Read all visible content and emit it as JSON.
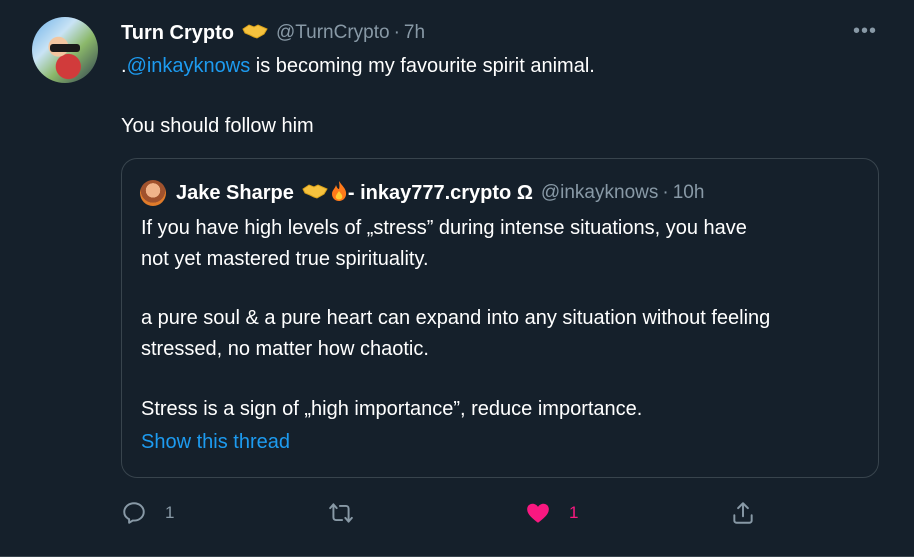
{
  "tweet": {
    "author_name": "Turn Crypto",
    "author_emoji": "handshake",
    "handle": "@TurnCrypto",
    "separator": "·",
    "time": "7h",
    "more_label": "•••",
    "text_prefix": ".",
    "mention": "@inkayknows",
    "text_suffix": " is becoming my favourite spirit animal.",
    "text_line2": "You should follow him"
  },
  "quote": {
    "author_name": "Jake Sharpe",
    "author_suffix": "- inkay777.crypto Ω",
    "handle": "@inkayknows",
    "separator": "·",
    "time": "10h",
    "lines": [
      "If you have high levels of „stress” during intense situations, you have",
      "not yet mastered true spirituality.",
      "a pure soul & a pure heart can expand into any situation without feeling",
      "stressed, no matter how chaotic.",
      "Stress is a sign of „high importance”, reduce importance."
    ],
    "show_thread": "Show this thread"
  },
  "actions": {
    "reply_count": "1",
    "retweet_count": "",
    "like_count": "1",
    "liked": true,
    "colors": {
      "muted": "#8899a6",
      "like": "#f91880",
      "link": "#1d9bf0",
      "background": "#15202b"
    }
  }
}
